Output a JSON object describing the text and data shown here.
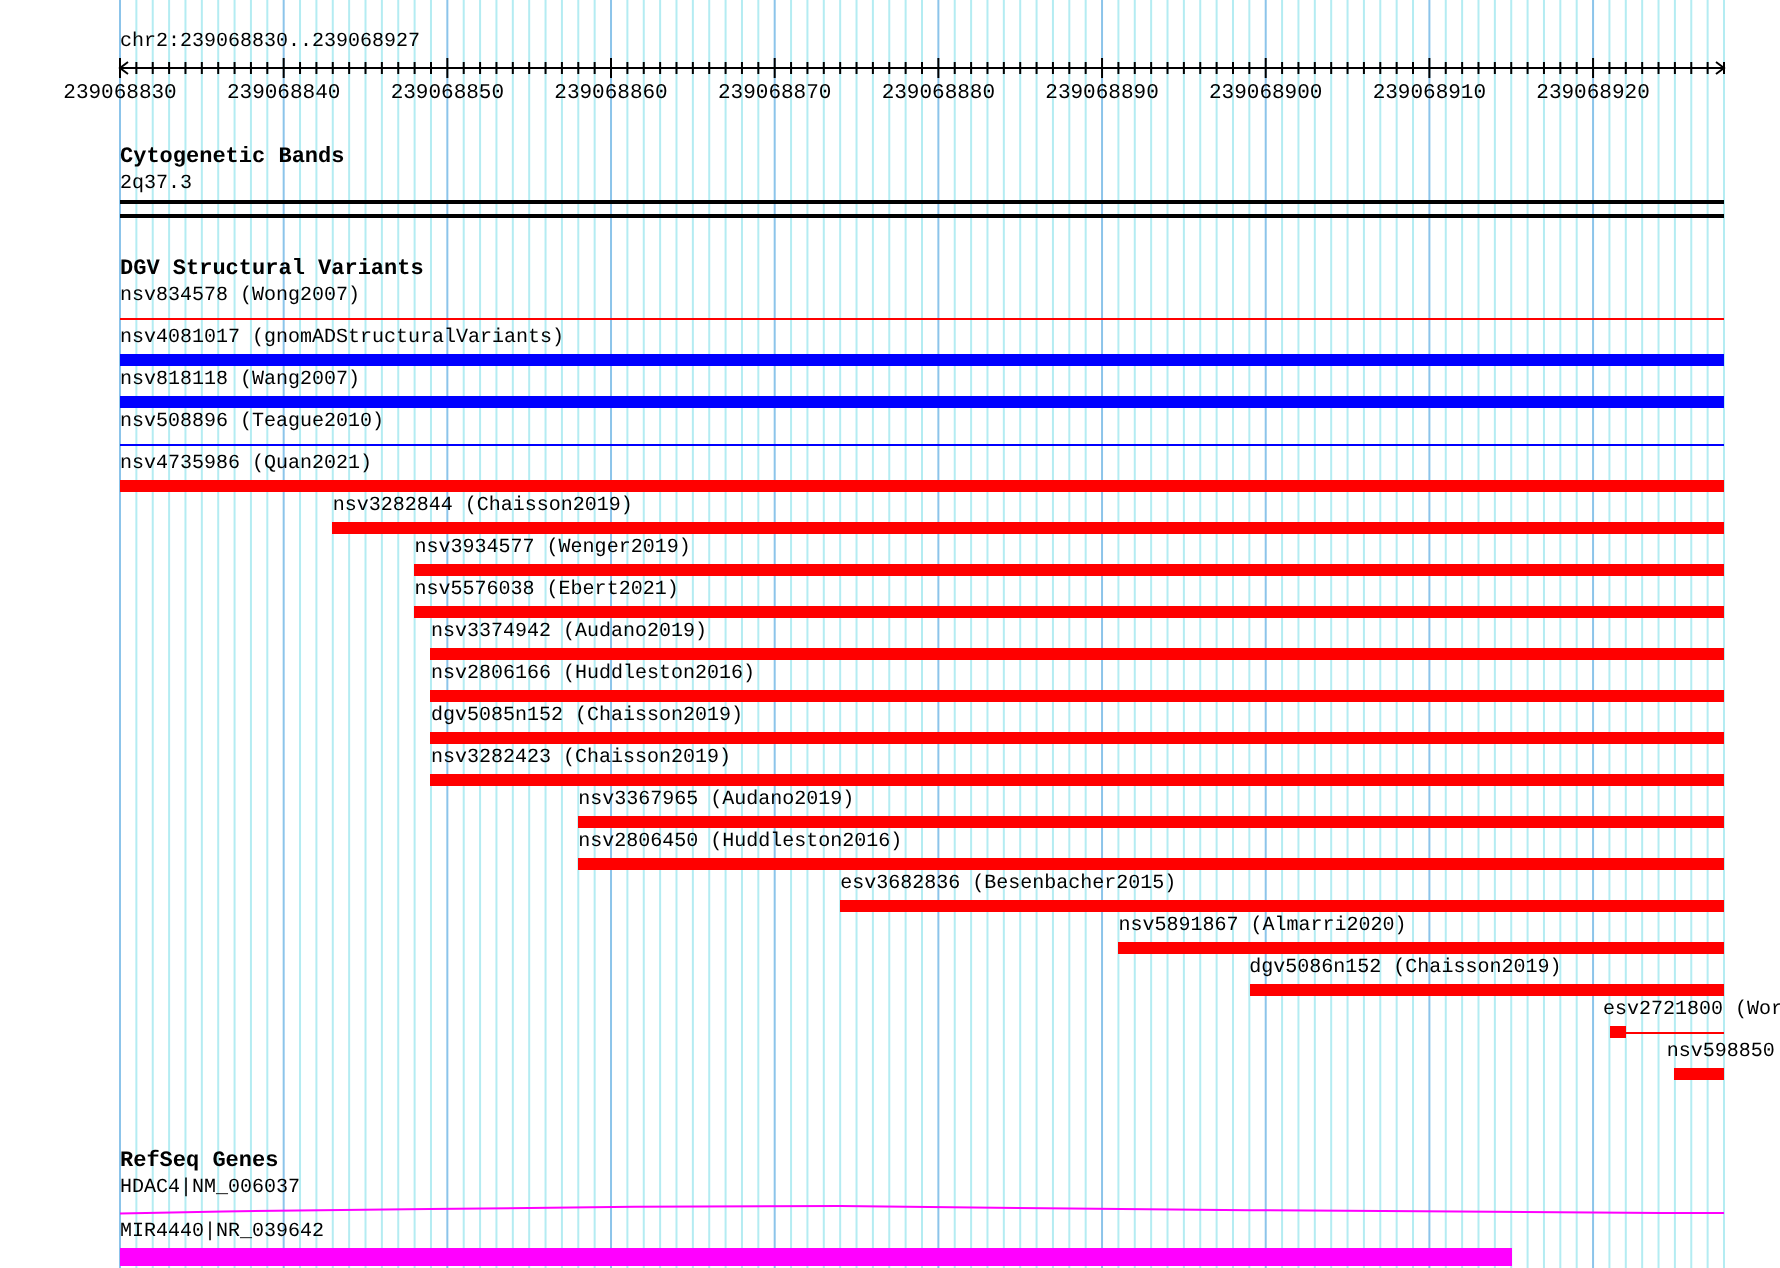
{
  "ruler": {
    "title": "chr2:239068830..239068927",
    "tick_labels": [
      "239068830",
      "239068840",
      "239068850",
      "239068860",
      "239068870",
      "239068880",
      "239068890",
      "239068900",
      "239068910",
      "239068920"
    ]
  },
  "tracks": [
    {
      "kind": "bands",
      "title": "Cytogenetic Bands",
      "features": [
        {
          "label": "2q37.3",
          "kind": "band"
        }
      ]
    },
    {
      "kind": "variants",
      "title": "DGV Structural Variants",
      "features": [
        {
          "label": "nsv834578 (Wong2007)",
          "kind": "line",
          "color": "#ff0000"
        },
        {
          "label": "nsv4081017 (gnomADStructuralVariants)",
          "kind": "bar",
          "color": "#0000ff"
        },
        {
          "label": "nsv818118 (Wang2007)",
          "kind": "bar",
          "color": "#0000ff"
        },
        {
          "label": "nsv508896 (Teague2010)",
          "kind": "line",
          "color": "#0000ff"
        },
        {
          "label": "nsv4735986 (Quan2021)",
          "kind": "bar",
          "color": "#ff0000"
        },
        {
          "label": "nsv3282844 (Chaisson2019)",
          "kind": "bar",
          "color": "#ff0000"
        },
        {
          "label": "nsv3934577 (Wenger2019)",
          "kind": "bar",
          "color": "#ff0000"
        },
        {
          "label": "nsv5576038 (Ebert2021)",
          "kind": "bar",
          "color": "#ff0000"
        },
        {
          "label": "nsv3374942 (Audano2019)",
          "kind": "bar",
          "color": "#ff0000"
        },
        {
          "label": "nsv2806166 (Huddleston2016)",
          "kind": "bar",
          "color": "#ff0000"
        },
        {
          "label": "dgv5085n152 (Chaisson2019)",
          "kind": "bar",
          "color": "#ff0000"
        },
        {
          "label": "nsv3282423 (Chaisson2019)",
          "kind": "bar",
          "color": "#ff0000"
        },
        {
          "label": "nsv3367965 (Audano2019)",
          "kind": "bar",
          "color": "#ff0000"
        },
        {
          "label": "nsv2806450 (Huddleston2016)",
          "kind": "bar",
          "color": "#ff0000"
        },
        {
          "label": "esv3682836 (Besenbacher2015)",
          "kind": "bar",
          "color": "#ff0000"
        },
        {
          "label": "nsv5891867 (Almarri2020)",
          "kind": "bar",
          "color": "#ff0000"
        },
        {
          "label": "dgv5086n152 (Chaisson2019)",
          "kind": "bar",
          "color": "#ff0000"
        },
        {
          "label": "esv2721800 (Wor",
          "kind": "box_line",
          "color": "#ff0000"
        },
        {
          "label": "nsv598850",
          "kind": "bar",
          "color": "#ff0000"
        }
      ]
    },
    {
      "kind": "genes",
      "title": "RefSeq Genes",
      "features": [
        {
          "label": "HDAC4|NM_006037",
          "kind": "intron",
          "color": "#ff00ff"
        },
        {
          "label": "MIR4440|NR_039642",
          "kind": "thick_bar",
          "color": "#ff00ff"
        }
      ]
    }
  ]
}
